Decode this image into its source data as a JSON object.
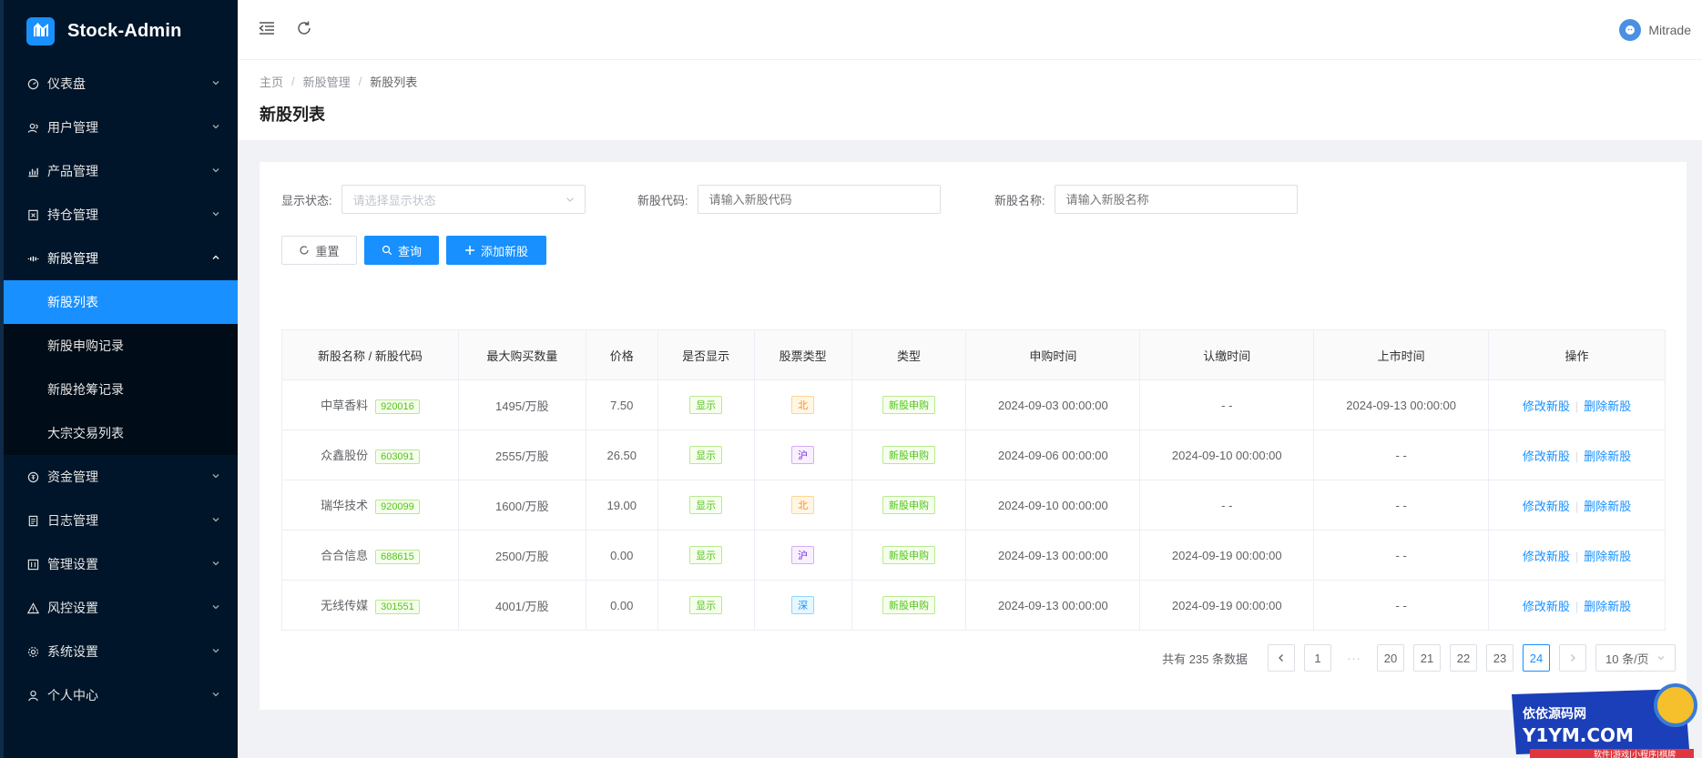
{
  "app": {
    "title": "Stock-Admin"
  },
  "header": {
    "user_name": "Mitrade"
  },
  "sidebar": {
    "items": [
      {
        "label": "仪表盘"
      },
      {
        "label": "用户管理"
      },
      {
        "label": "产品管理"
      },
      {
        "label": "持仓管理"
      },
      {
        "label": "新股管理"
      },
      {
        "label": "资金管理"
      },
      {
        "label": "日志管理"
      },
      {
        "label": "管理设置"
      },
      {
        "label": "风控设置"
      },
      {
        "label": "系统设置"
      },
      {
        "label": "个人中心"
      }
    ],
    "submenu": [
      {
        "label": "新股列表"
      },
      {
        "label": "新股申购记录"
      },
      {
        "label": "新股抢筹记录"
      },
      {
        "label": "大宗交易列表"
      }
    ]
  },
  "breadcrumb": [
    "主页",
    "新股管理",
    "新股列表"
  ],
  "page": {
    "title": "新股列表"
  },
  "filters": {
    "status_label": "显示状态:",
    "status_placeholder": "请选择显示状态",
    "code_label": "新股代码:",
    "code_placeholder": "请输入新股代码",
    "name_label": "新股名称:",
    "name_placeholder": "请输入新股名称"
  },
  "buttons": {
    "reset": "重置",
    "query": "查询",
    "add": "添加新股"
  },
  "table": {
    "columns": [
      "新股名称 / 新股代码",
      "最大购买数量",
      "价格",
      "是否显示",
      "股票类型",
      "类型",
      "申购时间",
      "认缴时间",
      "上市时间",
      "操作"
    ],
    "rows": [
      {
        "name": "中草香料",
        "code": "920016",
        "max": "1495/万股",
        "price": "7.50",
        "show": "显示",
        "stype": "北",
        "type": "新股申购",
        "apply": "2024-09-03 00:00:00",
        "pay": "- -",
        "list": "2024-09-13 00:00:00"
      },
      {
        "name": "众鑫股份",
        "code": "603091",
        "max": "2555/万股",
        "price": "26.50",
        "show": "显示",
        "stype": "沪",
        "type": "新股申购",
        "apply": "2024-09-06 00:00:00",
        "pay": "2024-09-10 00:00:00",
        "list": "- -"
      },
      {
        "name": "瑞华技术",
        "code": "920099",
        "max": "1600/万股",
        "price": "19.00",
        "show": "显示",
        "stype": "北",
        "type": "新股申购",
        "apply": "2024-09-10 00:00:00",
        "pay": "- -",
        "list": "- -"
      },
      {
        "name": "合合信息",
        "code": "688615",
        "max": "2500/万股",
        "price": "0.00",
        "show": "显示",
        "stype": "沪",
        "type": "新股申购",
        "apply": "2024-09-13 00:00:00",
        "pay": "2024-09-19 00:00:00",
        "list": "- -"
      },
      {
        "name": "无线传媒",
        "code": "301551",
        "max": "4001/万股",
        "price": "0.00",
        "show": "显示",
        "stype": "深",
        "type": "新股申购",
        "apply": "2024-09-13 00:00:00",
        "pay": "2024-09-19 00:00:00",
        "list": "- -"
      }
    ],
    "actions": {
      "edit": "修改新股",
      "delete": "删除新股"
    }
  },
  "pagination": {
    "total_text": "共有 235 条数据",
    "pages": [
      "1",
      "20",
      "21",
      "22",
      "23",
      "24"
    ],
    "current": "24",
    "ellipsis": "···",
    "page_size": "10 条/页"
  },
  "watermark": {
    "line1": "依依源码网",
    "line2": "Y1YM.COM",
    "line3": "软件|游戏|小程序|棋牌"
  },
  "colors": {
    "sidebar_bg": "#001529",
    "accent": "#1890ff",
    "page_bg": "#f0f2f5"
  }
}
